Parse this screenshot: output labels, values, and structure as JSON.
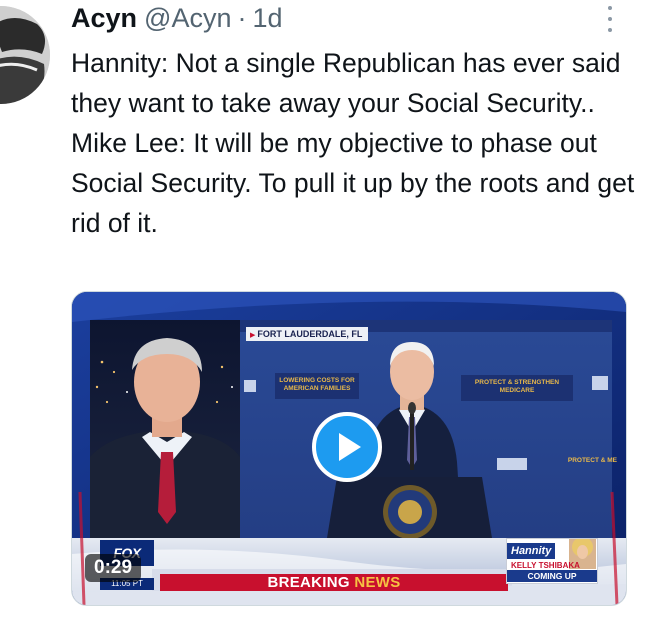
{
  "tweet": {
    "author_name": "Acyn",
    "author_handle": "@Acyn",
    "separator": "·",
    "timestamp": "1d",
    "text_lines": [
      "Hannity: Not a single Republican has ever said they want to take away your Social Security..",
      "Mike Lee: It will be my objective to phase out Social Security. To pull it up by the roots and get rid of it."
    ]
  },
  "video": {
    "duration": "0:29",
    "location_tag": "FORT LAUDERDALE, FL",
    "banner_left": "LOWERING COSTS FOR AMERICAN FAMILIES",
    "banner_right": "PROTECT & STRENGTHEN MEDICARE",
    "banner_far_right": "PROTECT & ME",
    "ticker_prefix": "BREAKING ",
    "ticker_accent": "NEWS",
    "network_logo": "FOX",
    "clock": "11:05 PT",
    "show_logo": "Hannity",
    "guest_name": "KELLY TSHIBAKA",
    "coming_up": "COMING UP"
  },
  "icons": {
    "more": "more-options-icon",
    "play": "play-icon"
  },
  "colors": {
    "accent": "#1d9bf0",
    "text_primary": "#0f1419",
    "text_secondary": "#536471",
    "ticker_red": "#c8102e"
  }
}
